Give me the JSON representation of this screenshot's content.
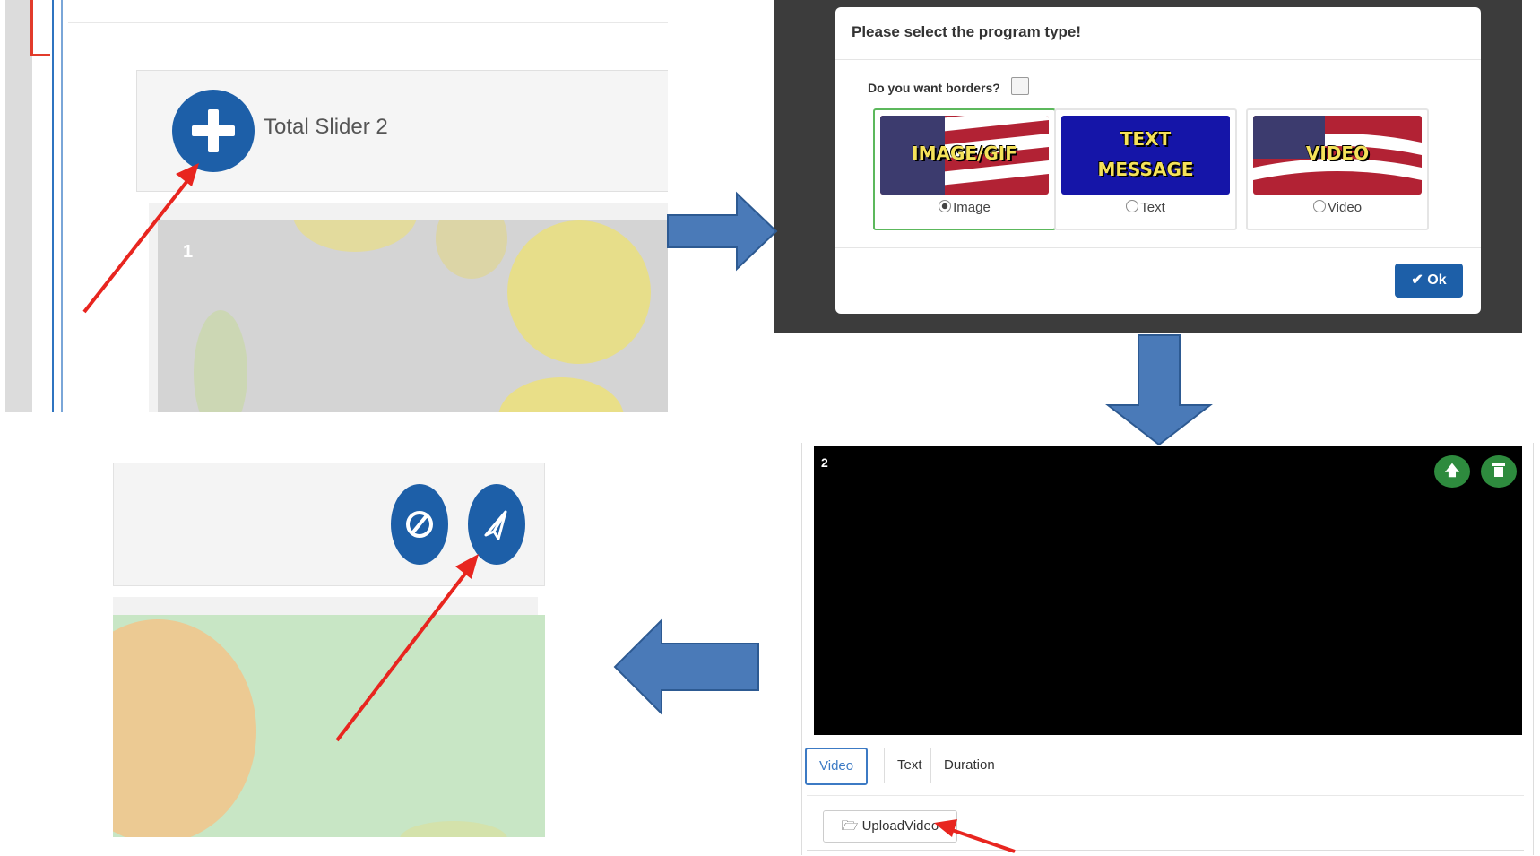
{
  "panel1": {
    "title": "Total Slider 2",
    "slide_number": "1",
    "add_icon": "plus-icon"
  },
  "dialog": {
    "title": "Please select the program type!",
    "border_question": "Do you want borders?",
    "options": [
      {
        "image_text": "IMAGE/GIF",
        "label": "Image",
        "selected": true
      },
      {
        "image_text_line1": "TEXT",
        "image_text_line2": "MESSAGE",
        "label": "Text",
        "selected": false
      },
      {
        "image_text": "VIDEO",
        "label": "Video",
        "selected": false
      }
    ],
    "ok_label": "Ok",
    "ok_icon": "check-icon"
  },
  "editor": {
    "slide_number": "2",
    "tabs": [
      "Video",
      "Text",
      "Duration"
    ],
    "active_tab": "Video",
    "upload_label": "UploadVideo",
    "upload_icon": "folder-open-icon",
    "move_up_icon": "arrow-up-icon",
    "delete_icon": "trash-icon"
  },
  "panel4": {
    "cancel_icon": "ban-icon",
    "send_icon": "paper-plane-icon"
  },
  "colors": {
    "primary_blue": "#1d5fa8",
    "flow_arrow": "#4a7ab8",
    "annotation_red": "#e8251f",
    "success_green": "#2e8b3e"
  }
}
